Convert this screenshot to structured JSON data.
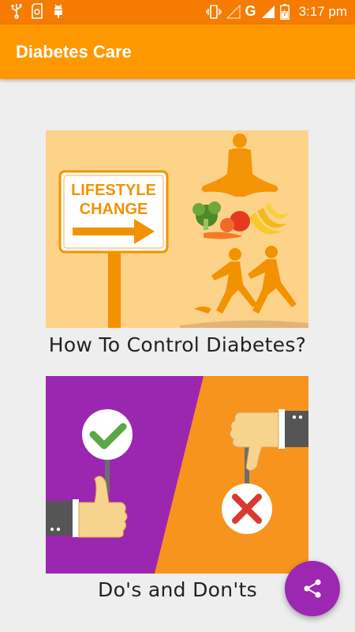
{
  "status_bar": {
    "time": "3:17 pm",
    "network": "G",
    "icons": [
      "usb-icon",
      "sd-card-icon",
      "android-debug-icon",
      "vibrate-icon",
      "signal-empty-icon",
      "signal-icon",
      "battery-charging-icon"
    ]
  },
  "app_bar": {
    "title": "Diabetes Care"
  },
  "cards": [
    {
      "label": "How To Control Diabetes?",
      "image_text": [
        "LIFESTYLE",
        "CHANGE"
      ]
    },
    {
      "label": "Do's and Don'ts"
    }
  ],
  "fab": {
    "icon": "share-icon"
  },
  "colors": {
    "status_bar": "#f57c00",
    "app_bar": "#ff9800",
    "fab": "#9c27b0",
    "background": "#eeeeee"
  }
}
